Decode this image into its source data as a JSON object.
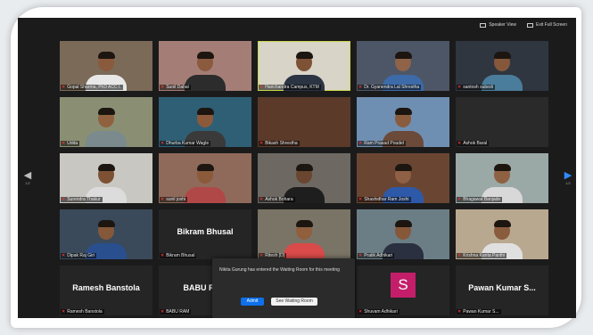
{
  "topbar": {
    "speaker_view": "Speaker View",
    "exit_full_screen": "Exit Full Screen"
  },
  "nav": {
    "page_left": "1/2",
    "page_right": "1/2"
  },
  "colors": {
    "accent": "#2d8cff",
    "active_speaker": "#c9d84a",
    "avatar_s": "#c41e6a",
    "muted_mic": "#e53935"
  },
  "participants": [
    {
      "name": "Gopal Sharma, PhD ACC I.",
      "bg": "#7b6a58",
      "skin": "#8a5a3c",
      "shirt": "#e8e8e8"
    },
    {
      "name": "Sunil Dahal",
      "bg": "#a47e76",
      "skin": "#8b5a3f",
      "shirt": "#2c2c2c"
    },
    {
      "name": "Harichandra Campus, KTM",
      "bg": "#d9d4c8",
      "skin": "#7d5237",
      "shirt": "#2a3442",
      "active": true
    },
    {
      "name": "Dr. Gyanendra Lal Shrestha",
      "bg": "#4d5666",
      "skin": "#8f6347",
      "shirt": "#3d6aa8"
    },
    {
      "name": "santosh subedi",
      "bg": "#2f3640",
      "skin": "#86583b",
      "shirt": "#4a7d9c"
    },
    {
      "name": "Udda",
      "bg": "#8a8f74",
      "skin": "#90613f",
      "shirt": "#7a8a8d"
    },
    {
      "name": "Dhurba Kumar Wagle",
      "bg": "#2f5f75",
      "skin": "#8c5a3b",
      "shirt": "#3a3a3a"
    },
    {
      "name": "Bikash Shrestha",
      "bg": "#5b3a2a",
      "skin": "#6e4a33",
      "shirt": "#5b3a2a",
      "no_person": true
    },
    {
      "name": "Ram Prasad Poudel",
      "bg": "#6f8fb2",
      "skin": "#8a5c3e",
      "shirt": "#6b4a3a"
    },
    {
      "name": "Ashok Baral",
      "bg": "#2a2a2a",
      "no_person": true
    },
    {
      "name": "Surendra Thakur",
      "bg": "#c9c7c2",
      "skin": "#7e5134",
      "shirt": "#dcdcdc"
    },
    {
      "name": "sunil joshi",
      "bg": "#8f6a5a",
      "skin": "#8a5a3b",
      "shirt": "#b04848"
    },
    {
      "name": "Ashok Bohara",
      "bg": "#6d6862",
      "skin": "#6a4530",
      "shirt": "#1e1e1e"
    },
    {
      "name": "Shashidhar Ram Joshi",
      "bg": "#6a4632",
      "skin": "#8e6045",
      "shirt": "#2e59a8"
    },
    {
      "name": "Bhagawat Banjade",
      "bg": "#9aa8a6",
      "skin": "#8e6142",
      "shirt": "#d8d8d8"
    },
    {
      "name": "Dipak Raj Giri",
      "bg": "#3a4a5a",
      "skin": "#85583a",
      "shirt": "#2a4f8f"
    },
    {
      "name": "Bikram Bhusal",
      "bg": "#252525",
      "big": true
    },
    {
      "name": "Ritesh [D]",
      "bg": "#7a7466",
      "skin": "#8f5f3e",
      "shirt": "#d94a4a"
    },
    {
      "name": "Pratik Adhikari",
      "bg": "#6b7e86",
      "skin": "#86583a",
      "shirt": "#2a3040"
    },
    {
      "name": "Krishna Kanta Panthi",
      "bg": "#b9a890",
      "skin": "#8a5c3e",
      "shirt": "#e0e0e0"
    },
    {
      "name": "Ramesh Banstola",
      "bg": "#252525",
      "big": true
    },
    {
      "name": "BABU RAM",
      "bg": "#252525",
      "big": true
    },
    {
      "name": "",
      "bg": "#252525",
      "no_person": true,
      "hidden_name": true
    },
    {
      "name": "Shuvam Adhikari",
      "bg": "#252525",
      "avatar": "S"
    },
    {
      "name": "Pawan Kumar S...",
      "bg": "#252525",
      "big": true
    }
  ],
  "popup": {
    "message": "Nikita Gurung has entered the Waiting Room for this meeting",
    "admit": "Admit",
    "see_waiting_room": "See Waiting Room"
  }
}
